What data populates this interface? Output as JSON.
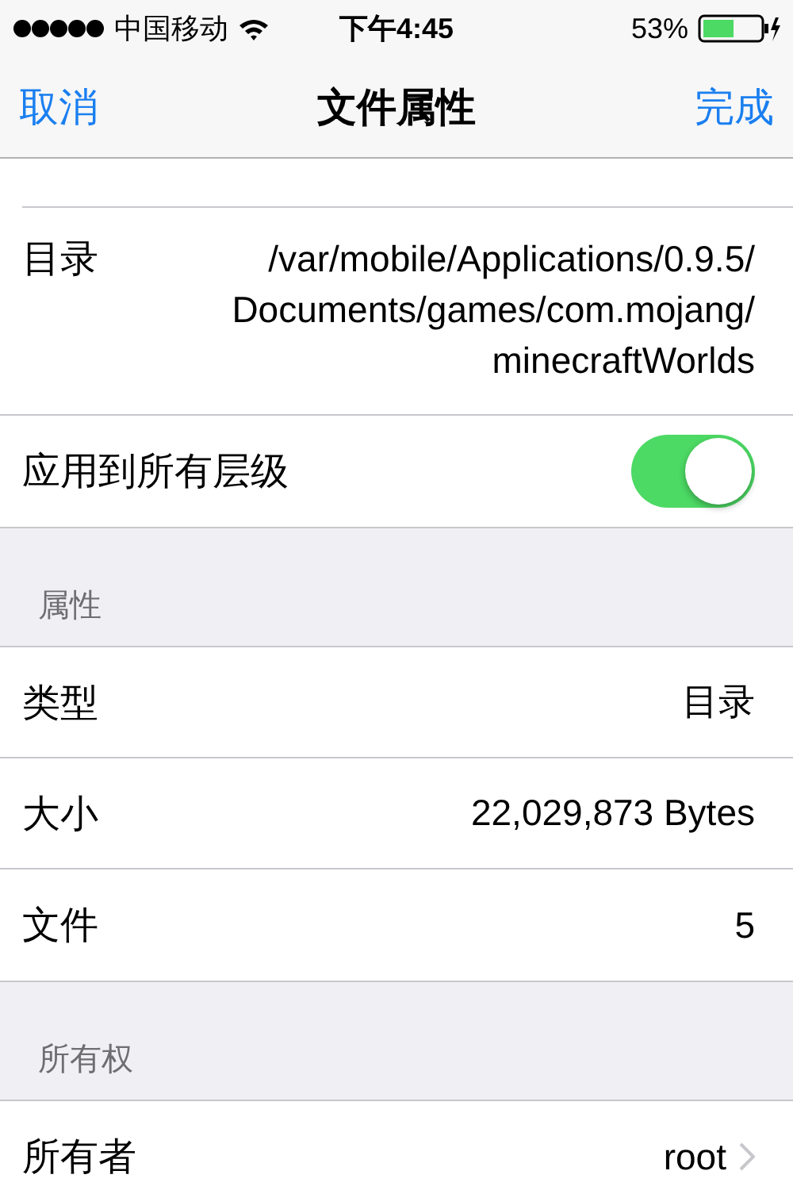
{
  "status_bar": {
    "carrier": "中国移动",
    "time": "下午4:45",
    "battery": "53%"
  },
  "nav": {
    "cancel": "取消",
    "title": "文件属性",
    "done": "完成"
  },
  "path_row": {
    "label": "目录",
    "lines": [
      "/var/mobile/Applications/0.9.5/",
      "Documents/games/com.mojang/",
      "minecraftWorlds"
    ]
  },
  "toggle_row": {
    "label": "应用到所有层级",
    "on": true
  },
  "sections": [
    {
      "header": "属性",
      "rows": [
        {
          "label": "类型",
          "value": "目录",
          "chevron": false
        },
        {
          "label": "大小",
          "value": "22,029,873 Bytes",
          "chevron": false
        },
        {
          "label": "文件",
          "value": "5",
          "chevron": false
        }
      ]
    },
    {
      "header": "所有权",
      "rows": [
        {
          "label": "所有者",
          "value": "root",
          "chevron": true
        }
      ]
    }
  ]
}
